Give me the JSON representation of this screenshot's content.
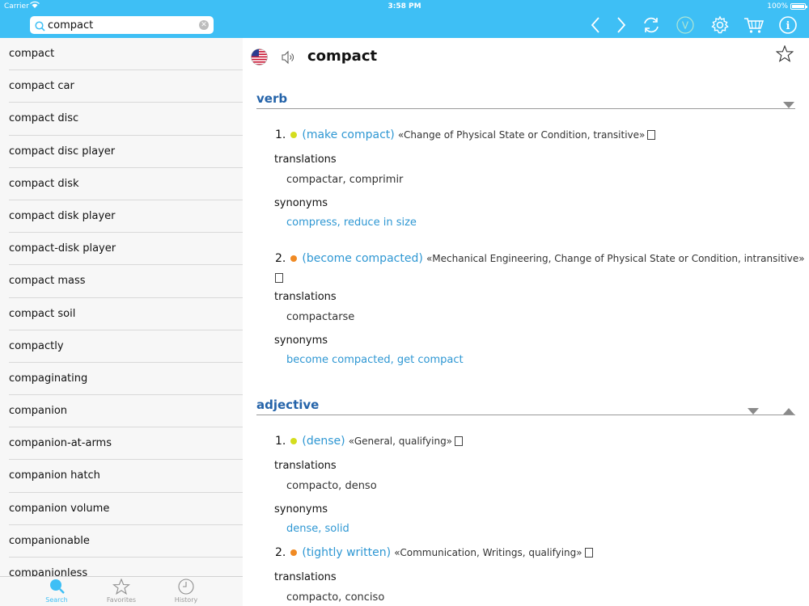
{
  "status": {
    "carrier": "Carrier",
    "time": "3:58 PM",
    "battery": "100%"
  },
  "search": {
    "query": "compact"
  },
  "toolbar": {
    "icons": [
      "back-icon",
      "forward-icon",
      "sync-icon",
      "v-icon",
      "gear-icon",
      "cart-icon",
      "info-icon"
    ],
    "v_label": "V",
    "info_label": "i"
  },
  "word_list": [
    "compact",
    "compact car",
    "compact disc",
    "compact disc player",
    "compact disk",
    "compact disk player",
    "compact-disk player",
    "compact mass",
    "compact soil",
    "compactly",
    "compaginating",
    "companion",
    "companion-at-arms",
    "companion hatch",
    "companion volume",
    "companionable",
    "companionless"
  ],
  "tabs": [
    {
      "label": "Search",
      "icon": "search-icon",
      "active": true
    },
    {
      "label": "Favorites",
      "icon": "star-icon",
      "active": false
    },
    {
      "label": "History",
      "icon": "clock-icon",
      "active": false
    }
  ],
  "entry": {
    "headword": "compact",
    "flag": "us-flag-icon",
    "verb": {
      "pos": "verb",
      "senses": [
        {
          "num": "1.",
          "dot_color": "#d4dd1e",
          "gloss": "(make compact)",
          "meta": "«Change of Physical State or Condition, transitive»",
          "translations_label": "translations",
          "translations": "compactar, comprimir",
          "synonyms_label": "synonyms",
          "synonyms": "compress, reduce in size"
        },
        {
          "num": "2.",
          "dot_color": "#f08a24",
          "gloss": "(become compacted)",
          "meta": "«Mechanical Engineering, Change of Physical State or Condition, intransitive»",
          "translations_label": "translations",
          "translations": "compactarse",
          "synonyms_label": "synonyms",
          "synonyms": "become compacted, get compact"
        }
      ]
    },
    "adjective": {
      "pos": "adjective",
      "senses": [
        {
          "num": "1.",
          "dot_color": "#d4dd1e",
          "gloss": "(dense)",
          "meta": "«General, qualifying»",
          "translations_label": "translations",
          "translations": "compacto, denso",
          "synonyms_label": "synonyms",
          "synonyms": "dense, solid"
        },
        {
          "num": "2.",
          "dot_color": "#f08a24",
          "gloss": "(tightly written)",
          "meta": "«Communication, Writings, qualifying»",
          "translations_label": "translations",
          "translations": "compacto, conciso"
        }
      ]
    }
  },
  "colors": {
    "accent": "#3ebff5",
    "pos_header": "#2463a9",
    "link": "#2e97d3"
  }
}
